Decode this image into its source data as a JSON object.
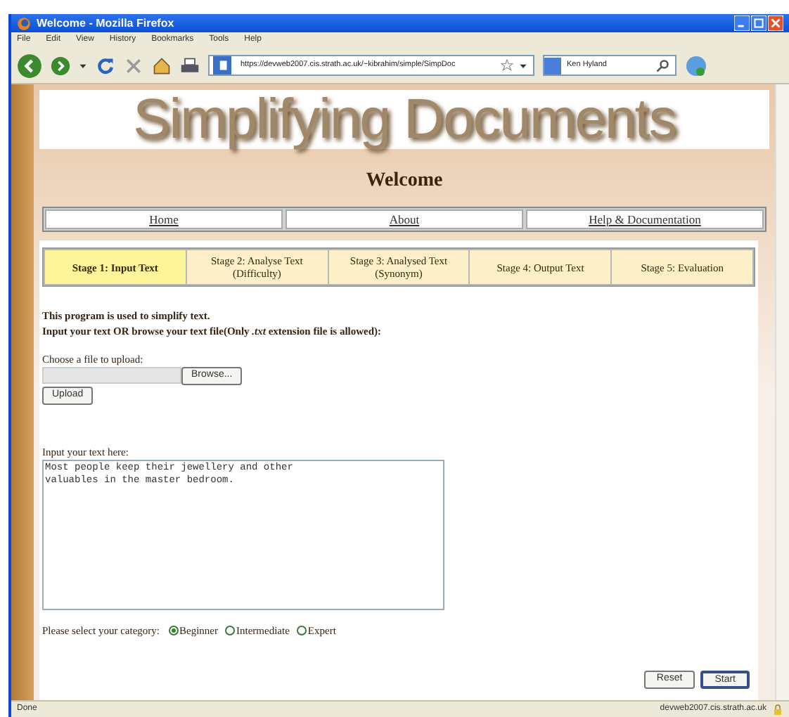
{
  "window": {
    "title": "Welcome - Mozilla Firefox"
  },
  "menu": [
    "File",
    "Edit",
    "View",
    "History",
    "Bookmarks",
    "Tools",
    "Help"
  ],
  "toolbar": {
    "url": "https://devweb2007.cis.strath.ac.uk/~kibrahim/simple/SimpDoc",
    "search": "Ken Hyland"
  },
  "page": {
    "logo": "Simplifying Documents",
    "heading": "Welcome",
    "nav": [
      "Home",
      "About",
      "Help & Documentation"
    ],
    "stages": [
      {
        "label": "Stage 1: Input Text",
        "selected": true
      },
      {
        "label": "Stage 2: Analyse Text (Difficulty)",
        "selected": false
      },
      {
        "label": "Stage 3: Analysed Text (Synonym)",
        "selected": false
      },
      {
        "label": "Stage 4: Output Text",
        "selected": false
      },
      {
        "label": "Stage 5: Evaluation",
        "selected": false
      }
    ],
    "intro": [
      "This program is used to simplify text.",
      "Input your text OR browse your text file(Only *.txt* extension file is allowed):"
    ],
    "upload_label": "Choose a file to upload:",
    "browse_button": "Browse...",
    "upload_button": "Upload",
    "text_label": "Input your text here:",
    "text_value": "Most people keep their jewellery and other\nvaluables in the master bedroom.",
    "category_label": "Please select your category:",
    "categories": [
      {
        "label": "Beginner",
        "selected": true
      },
      {
        "label": "Intermediate",
        "selected": false
      },
      {
        "label": "Expert",
        "selected": false
      }
    ],
    "buttons": [
      "Reset",
      "Start"
    ]
  },
  "status_bar": {
    "text": "Done",
    "host": "devweb2007.cis.strath.ac.uk"
  }
}
